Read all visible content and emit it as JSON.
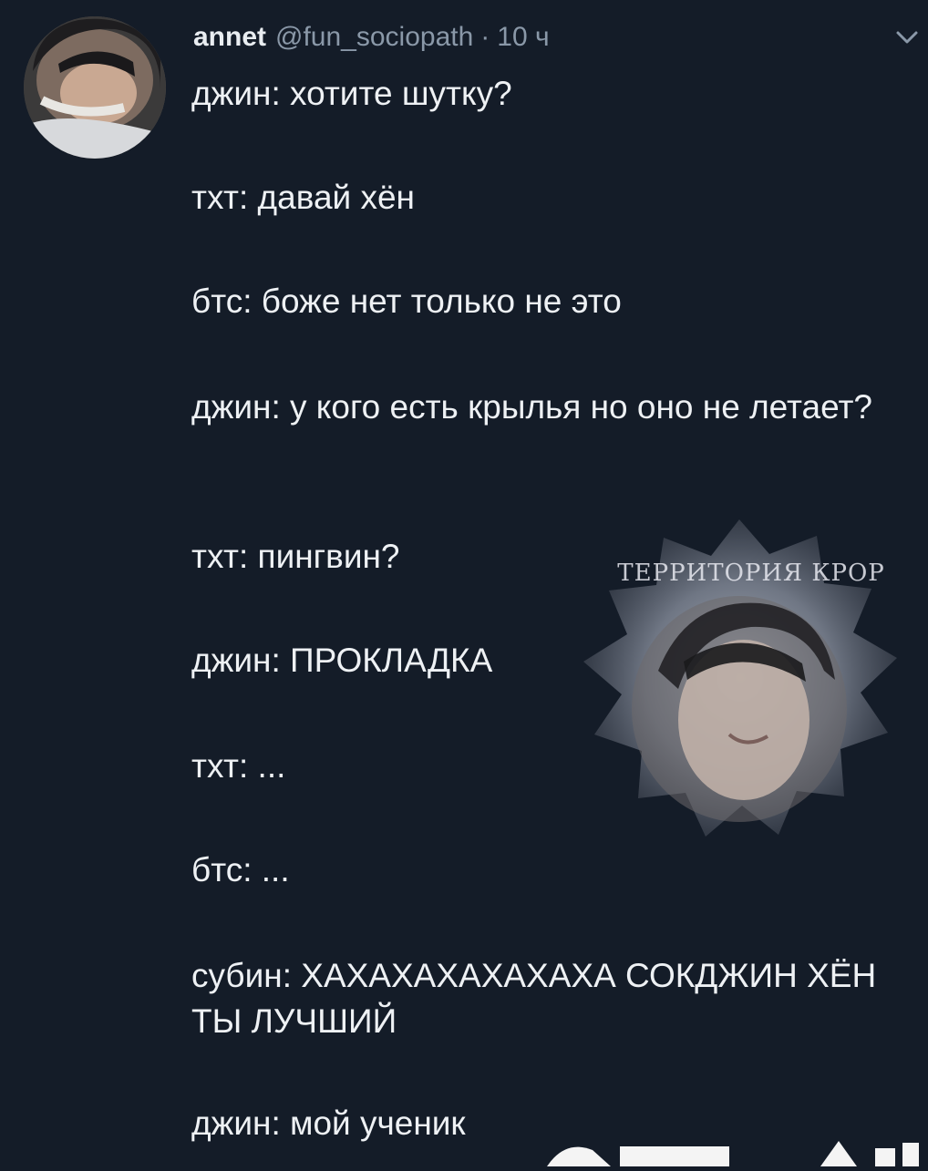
{
  "tweet": {
    "display_name": "annet",
    "handle": "@fun_sociopath",
    "separator": "·",
    "time": "10 ч",
    "lines": [
      "джин: хотите шутку?",
      "тхт: давай хён",
      "бтс: боже нет только не это",
      "джин: у кого есть крылья но оно не летает?",
      "тхт: пингвин?",
      "джин: ПРОКЛАДКА",
      "тхт: ...",
      "бтс: ...",
      "субин: ХАХАХАХАХАХАХА СОКДЖИН ХЁН ТЫ ЛУЧШИЙ",
      "джин: мой ученик"
    ]
  },
  "watermark": {
    "text": "ТЕРРИТОРИЯ КРОР"
  },
  "icons": {
    "menu": "chevron-down-icon",
    "avatar": "avatar",
    "watermark": "watermark-badge"
  }
}
